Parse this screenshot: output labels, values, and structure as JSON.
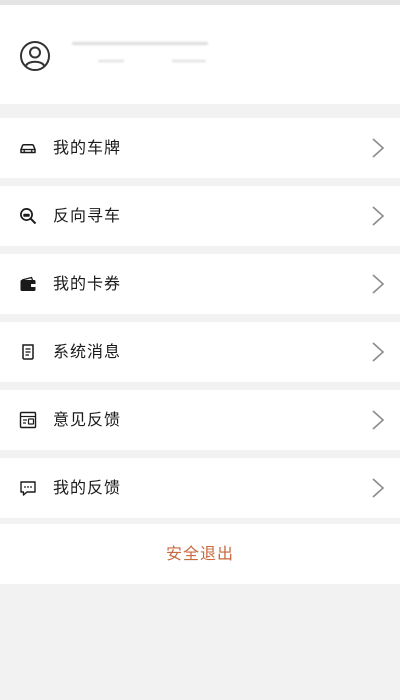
{
  "colors": {
    "logout": "#c8693f",
    "icon": "#1a1a1a",
    "chevron": "#8a8a8a"
  },
  "profile": {
    "avatar_icon": "user-circle-icon"
  },
  "menu": [
    {
      "label": "我的车牌",
      "icon": "car-icon"
    },
    {
      "label": "反向寻车",
      "icon": "search-car-icon"
    },
    {
      "label": "我的卡券",
      "icon": "wallet-icon"
    },
    {
      "label": "系统消息",
      "icon": "message-doc-icon"
    },
    {
      "label": "意见反馈",
      "icon": "feedback-form-icon"
    },
    {
      "label": "我的反馈",
      "icon": "chat-bubble-icon"
    }
  ],
  "logout_label": "安全退出"
}
